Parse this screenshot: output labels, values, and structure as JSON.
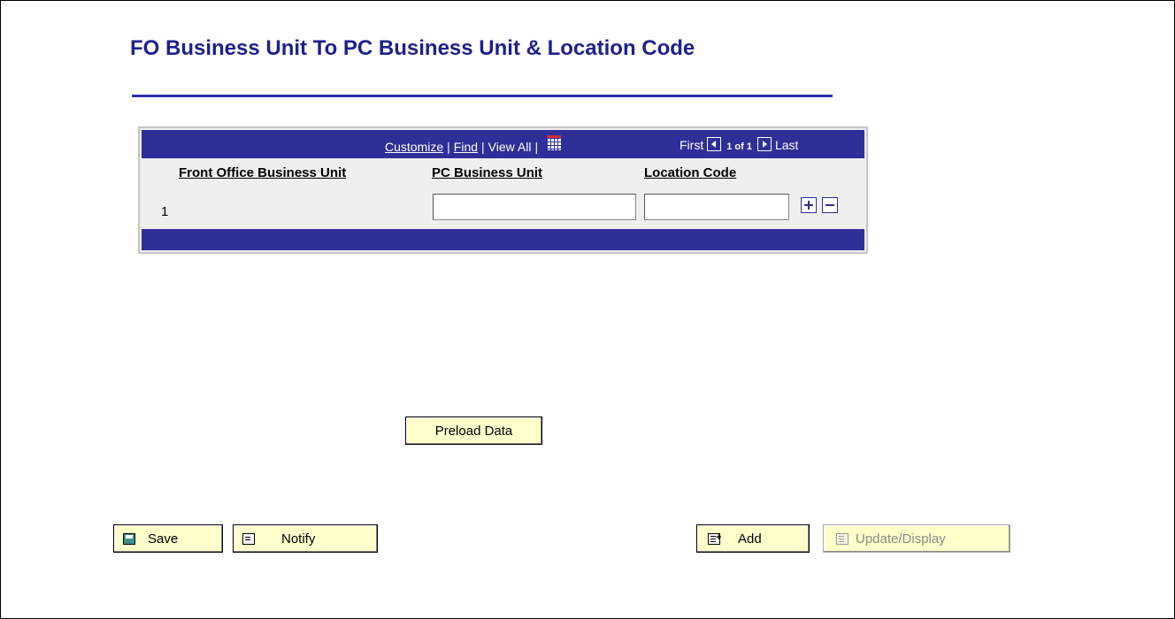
{
  "page": {
    "title": "FO Business Unit To PC Business Unit & Location Code"
  },
  "grid": {
    "nav": {
      "customize": "Customize",
      "find": "Find",
      "view_all": "View All",
      "separator": "|",
      "view_grid_icon": "grid-view-icon",
      "first": "First",
      "count": "1 of 1",
      "last": "Last"
    },
    "columns": [
      "Front Office Business Unit",
      "PC Business Unit",
      "Location Code"
    ],
    "rows": [
      {
        "row_number": "1",
        "front_office_business_unit": "",
        "pc_business_unit": "",
        "location_code": ""
      }
    ],
    "add_row_icon": "plus-icon",
    "delete_row_icon": "minus-icon"
  },
  "actions": {
    "preload_data": "Preload Data"
  },
  "toolbar": {
    "save": "Save",
    "notify": "Notify",
    "add": "Add",
    "update_display": "Update/Display"
  },
  "colors": {
    "title": "#1f1f8f",
    "grid_header": "#2f2f99",
    "button_background": "#ffffcc"
  }
}
